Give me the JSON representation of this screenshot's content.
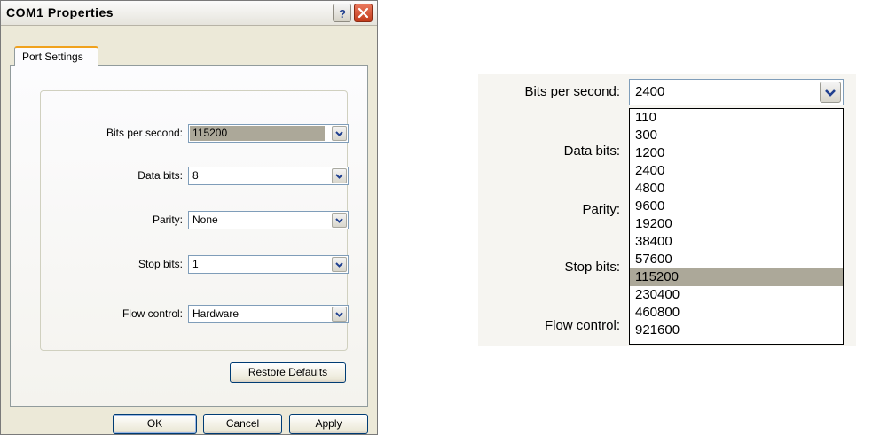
{
  "dialog": {
    "title": "COM1  Properties",
    "tab": "Port Settings",
    "fields": [
      {
        "label": "Bits per second:",
        "value": "115200"
      },
      {
        "label": "Data bits:",
        "value": "8"
      },
      {
        "label": "Parity:",
        "value": "None"
      },
      {
        "label": "Stop bits:",
        "value": "1"
      },
      {
        "label": "Flow control:",
        "value": "Hardware"
      }
    ],
    "restore_defaults": "Restore Defaults",
    "buttons": {
      "ok": "OK",
      "cancel": "Cancel",
      "apply": "Apply"
    }
  },
  "zoom": {
    "labels": {
      "bits_per_second": "Bits per second:",
      "data_bits": "Data bits:",
      "parity": "Parity:",
      "stop_bits": "Stop bits:",
      "flow_control": "Flow control:"
    },
    "combo_value": "2400",
    "options": [
      "110",
      "300",
      "1200",
      "2400",
      "4800",
      "9600",
      "19200",
      "38400",
      "57600",
      "115200",
      "230400",
      "460800",
      "921600"
    ],
    "highlighted_option": "115200"
  },
  "colors": {
    "selection": "#aca899",
    "close_button": "#c23b1b",
    "tab_accent": "#f0a21e"
  },
  "icons": {
    "help": "help-icon",
    "close": "close-icon",
    "dropdown": "chevron-down-icon"
  }
}
